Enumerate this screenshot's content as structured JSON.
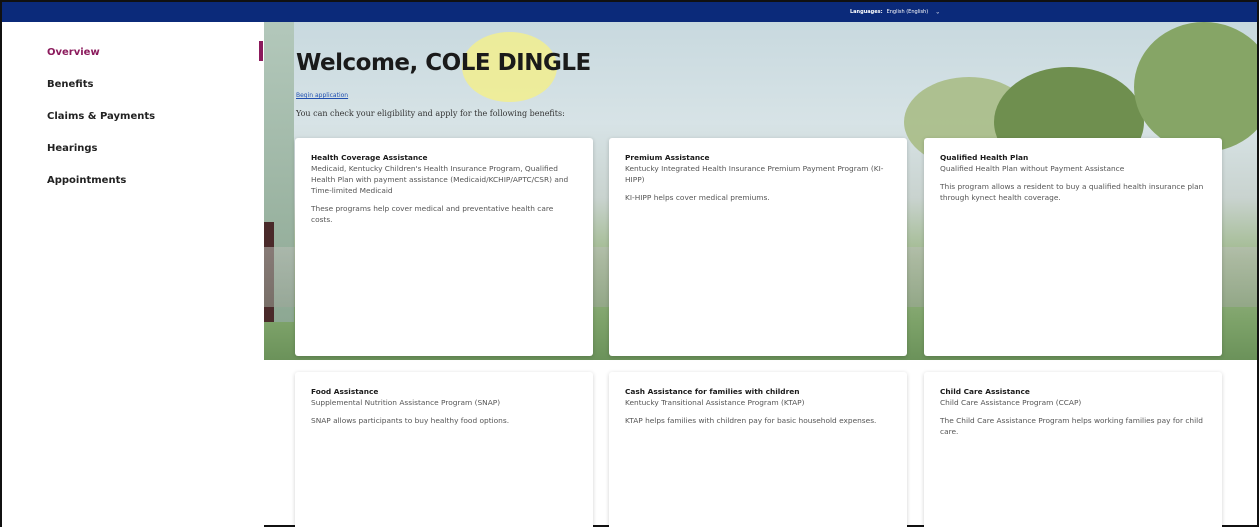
{
  "topbar": {
    "languages_label": "Languages:",
    "language_value": "English (English)"
  },
  "sidebar": {
    "items": [
      {
        "label": "Overview"
      },
      {
        "label": "Benefits"
      },
      {
        "label": "Claims & Payments"
      },
      {
        "label": "Hearings"
      },
      {
        "label": "Appointments"
      }
    ]
  },
  "hero": {
    "welcome": "Welcome, COLE DINGLE",
    "link_text": "Begin application",
    "intro": "You can check your eligibility and apply for the following benefits:"
  },
  "cards": [
    {
      "title": "Health Coverage Assistance",
      "subtitle": "Medicaid, Kentucky Children's Health Insurance Program, Qualified Health Plan with payment assistance (Medicaid/KCHIP/APTC/CSR) and Time-limited Medicaid",
      "description": "These programs help cover medical and preventative health care costs."
    },
    {
      "title": "Premium Assistance",
      "subtitle": "Kentucky Integrated Health Insurance Premium Payment Program (KI-HIPP)",
      "description": "KI-HIPP helps cover medical premiums."
    },
    {
      "title": "Qualified Health Plan",
      "subtitle": "Qualified Health Plan without Payment Assistance",
      "description": "This program allows a resident to buy a qualified health insurance plan through kynect health coverage."
    },
    {
      "title": "Food Assistance",
      "subtitle": "Supplemental Nutrition Assistance Program (SNAP)",
      "description": "SNAP allows participants to buy healthy food options."
    },
    {
      "title": "Cash Assistance for families with children",
      "subtitle": "Kentucky Transitional Assistance Program (KTAP)",
      "description": "KTAP helps families with children pay for basic household expenses."
    },
    {
      "title": "Child Care Assistance",
      "subtitle": "Child Care Assistance Program (CCAP)",
      "description": "The Child Care Assistance Program helps working families pay for child care."
    }
  ],
  "colors": {
    "topbar": "#0b2a7a",
    "accent": "#8b1a5c",
    "link": "#1f4fb0"
  }
}
